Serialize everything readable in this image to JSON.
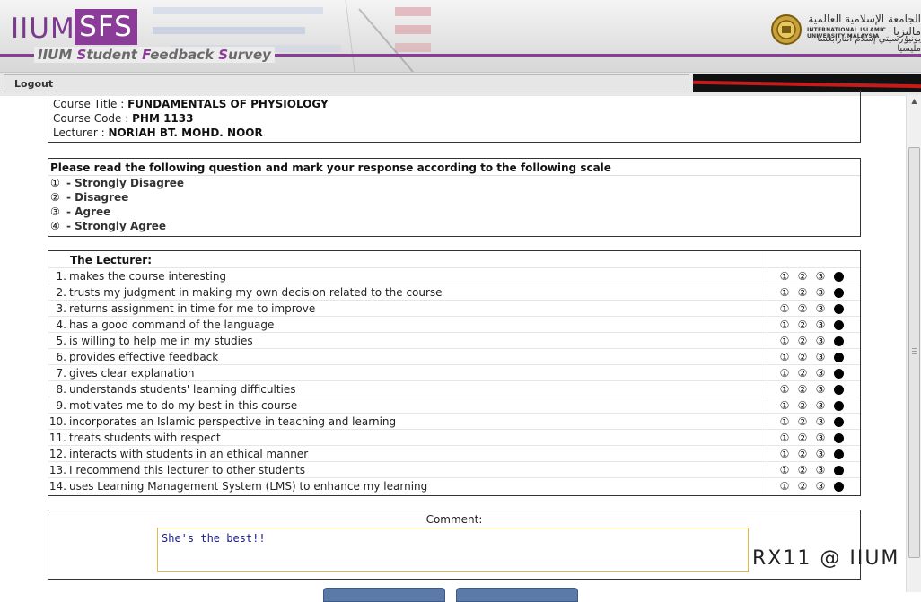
{
  "header": {
    "logo_main": "IIUM",
    "logo_accent": "SFS",
    "logo_sub_parts": [
      "IIUM ",
      "S",
      "tudent ",
      "F",
      "eedback ",
      "S",
      "urvey"
    ],
    "university_name_ar": "الجامعة الإسلامية العالمية ماليزيا",
    "university_name_en": "INTERNATIONAL ISLAMIC UNIVERSITY MALAYSIA",
    "university_name_ar2": "يونيۏرسيتي إسلام انتارابڠسا مليسيا",
    "accent_color": "#8a3c98"
  },
  "toolbar": {
    "logout_label": "Logout",
    "user_redacted": true
  },
  "course": {
    "title_label": "Course Title : ",
    "title_value": "FUNDAMENTALS OF PHYSIOLOGY",
    "code_label": "Course Code : ",
    "code_value": "PHM 1133",
    "lecturer_label": "Lecturer : ",
    "lecturer_value": "NORIAH BT. MOHD. NOOR"
  },
  "scale": {
    "instruction": "Please read the following question and mark your response according to the following scale",
    "items": [
      {
        "num": "①",
        "label": "- Strongly Disagree"
      },
      {
        "num": "②",
        "label": "- Disagree"
      },
      {
        "num": "③",
        "label": "- Agree"
      },
      {
        "num": "④",
        "label": "- Strongly Agree"
      }
    ]
  },
  "questions": {
    "heading": "The Lecturer:",
    "option_glyphs": [
      "①",
      "②",
      "③",
      "④"
    ],
    "items": [
      {
        "num": "1.",
        "text": "makes the course interesting",
        "selected": 4
      },
      {
        "num": "2.",
        "text": "trusts my judgment in making my own decision related to the course",
        "selected": 4
      },
      {
        "num": "3.",
        "text": "returns assignment in time for me to improve",
        "selected": 4
      },
      {
        "num": "4.",
        "text": "has a good command of the language",
        "selected": 4
      },
      {
        "num": "5.",
        "text": "is willing to help me in my studies",
        "selected": 4
      },
      {
        "num": "6.",
        "text": "provides effective feedback",
        "selected": 4
      },
      {
        "num": "7.",
        "text": "gives clear explanation",
        "selected": 4
      },
      {
        "num": "8.",
        "text": "understands students' learning difficulties",
        "selected": 4
      },
      {
        "num": "9.",
        "text": "motivates me to do my best in this course",
        "selected": 4
      },
      {
        "num": "10.",
        "text": "incorporates an Islamic perspective in teaching and learning",
        "selected": 4
      },
      {
        "num": "11.",
        "text": "treats students with respect",
        "selected": 4
      },
      {
        "num": "12.",
        "text": "interacts with students in an ethical manner",
        "selected": 4
      },
      {
        "num": "13.",
        "text": "I recommend this lecturer to other students",
        "selected": 4
      },
      {
        "num": "14.",
        "text": "uses Learning Management System (LMS) to enhance my learning",
        "selected": 4
      }
    ]
  },
  "comment": {
    "label": "Comment:",
    "value": "She's the best!!"
  },
  "watermark": "RX11 @ IIUM"
}
